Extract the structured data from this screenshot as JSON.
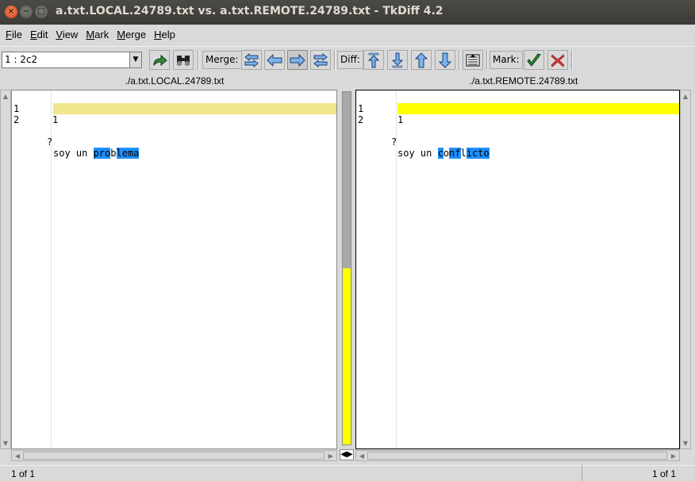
{
  "window": {
    "title": "a.txt.LOCAL.24789.txt vs. a.txt.REMOTE.24789.txt - TkDiff 4.2",
    "close_glyph": "×",
    "min_glyph": "−",
    "max_glyph": "□"
  },
  "menu": {
    "items": [
      {
        "hot": "F",
        "rest": "ile"
      },
      {
        "hot": "E",
        "rest": "dit"
      },
      {
        "hot": "V",
        "rest": "iew"
      },
      {
        "hot": "M",
        "rest": "ark"
      },
      {
        "hot": "M",
        "rest": "erge"
      },
      {
        "hot": "H",
        "rest": "elp"
      }
    ]
  },
  "toolbar": {
    "diff_select_value": "1    : 2c2",
    "merge_label": "Merge:",
    "diff_label": "Diff:",
    "mark_label": "Mark:",
    "colors": {
      "green_arrow": "#2e8b3a",
      "blue_arrow": "#7fb2e8",
      "red_x": "#d63a3a"
    }
  },
  "left": {
    "filename": "./a.txt.LOCAL.24789.txt",
    "lines": [
      {
        "num": "1",
        "mark": "",
        "segments": [
          {
            "t": "1",
            "hl": false
          }
        ]
      },
      {
        "num": "2",
        "mark": "?",
        "segments": [
          {
            "t": "soy un ",
            "hl": false
          },
          {
            "t": "pro",
            "hl": true
          },
          {
            "t": "b",
            "hl": false
          },
          {
            "t": "lema",
            "hl": true
          }
        ]
      }
    ],
    "diff_line_color": "#f0e68c",
    "status": "1 of 1"
  },
  "right": {
    "filename": "./a.txt.REMOTE.24789.txt",
    "lines": [
      {
        "num": "1",
        "mark": "",
        "segments": [
          {
            "t": "1",
            "hl": false
          }
        ]
      },
      {
        "num": "2",
        "mark": "?",
        "segments": [
          {
            "t": "soy un ",
            "hl": false
          },
          {
            "t": "c",
            "hl": true
          },
          {
            "t": "o",
            "hl": false
          },
          {
            "t": "nf",
            "hl": true
          },
          {
            "t": "l",
            "hl": false
          },
          {
            "t": "icto",
            "hl": true
          }
        ]
      }
    ],
    "diff_line_color": "#ffff00",
    "status": "1 of 1"
  },
  "map": {
    "highlight_fraction": 0.5,
    "highlight_color": "#ffff00"
  }
}
